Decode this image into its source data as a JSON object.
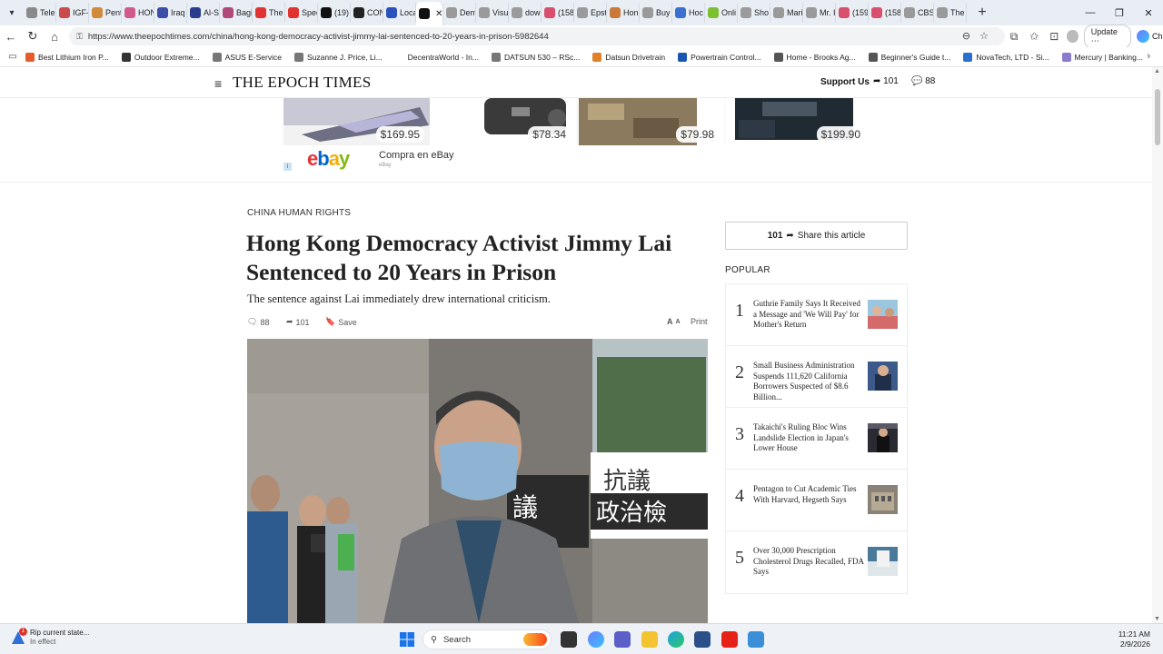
{
  "browser": {
    "tabs": [
      {
        "label": "Tele",
        "color": "#8a8a8a"
      },
      {
        "label": "IGF-",
        "color": "#c94b4b"
      },
      {
        "label": "Pent",
        "color": "#d18a3a"
      },
      {
        "label": "HON",
        "color": "#d25a8a"
      },
      {
        "label": "Iraq",
        "color": "#3b4fa8"
      },
      {
        "label": "Al-S",
        "color": "#2a3d8f"
      },
      {
        "label": "Bagi",
        "color": "#b14a7b"
      },
      {
        "label": "The",
        "color": "#e0332f"
      },
      {
        "label": "Spec",
        "color": "#e0332f"
      },
      {
        "label": "(19)",
        "color": "#111111"
      },
      {
        "label": "CON",
        "color": "#222222"
      },
      {
        "label": "Loca",
        "color": "#2a52be"
      },
      {
        "label": "",
        "color": "#111111",
        "active": true
      },
      {
        "label": "Dem",
        "color": "#9a9a9a"
      },
      {
        "label": "Visu",
        "color": "#9a9a9a"
      },
      {
        "label": "dow",
        "color": "#9a9a9a"
      },
      {
        "label": "(158",
        "color": "#d94f6e"
      },
      {
        "label": "Epst",
        "color": "#9a9a9a"
      },
      {
        "label": "Hon",
        "color": "#c97a3a"
      },
      {
        "label": "Buy",
        "color": "#9a9a9a"
      },
      {
        "label": "Hoc",
        "color": "#3b6fd0"
      },
      {
        "label": "Onli",
        "color": "#7cbf2f"
      },
      {
        "label": "Sho",
        "color": "#9a9a9a"
      },
      {
        "label": "Mari",
        "color": "#9a9a9a"
      },
      {
        "label": "Mr. I",
        "color": "#9a9a9a"
      },
      {
        "label": "(159",
        "color": "#d94f6e"
      },
      {
        "label": "(158",
        "color": "#d94f6e"
      },
      {
        "label": "CBS",
        "color": "#9a9a9a"
      },
      {
        "label": "The",
        "color": "#9a9a9a"
      }
    ],
    "url": "https://www.theepochtimes.com/china/hong-kong-democracy-activist-jimmy-lai-sentenced-to-20-years-in-prison-5982644",
    "update_label": "Update",
    "chat_label": "Chat",
    "bookmarks": [
      {
        "label": "Best Lithium Iron P...",
        "color": "#e55b2b"
      },
      {
        "label": "Outdoor Extreme...",
        "color": "#333333"
      },
      {
        "label": "ASUS E-Service",
        "color": "#777777"
      },
      {
        "label": "Suzanne J. Price, Li...",
        "color": "#777777"
      },
      {
        "label": "DecentraWorld - In...",
        "color": "#ffffff"
      },
      {
        "label": "DATSUN 530 – RSc...",
        "color": "#777777"
      },
      {
        "label": "Datsun Drivetrain",
        "color": "#e0802b"
      },
      {
        "label": "Powertrain Control...",
        "color": "#1a56b0"
      },
      {
        "label": "Home - Brooks Ag...",
        "color": "#555555"
      },
      {
        "label": "Beginner's Guide t...",
        "color": "#555555"
      },
      {
        "label": "NovaTech, LTD - Si...",
        "color": "#2a6fd0"
      },
      {
        "label": "Mercury | Banking...",
        "color": "#8a7bd0"
      }
    ]
  },
  "site": {
    "logo": "THE EPOCH TIMES",
    "support_label": "Support Us",
    "share_count": "101",
    "comment_count": "88"
  },
  "ad": {
    "items": [
      {
        "price": "$169.95"
      },
      {
        "price": "$78.34"
      },
      {
        "price": "$79.98"
      },
      {
        "price": "$199.90"
      }
    ],
    "logo": {
      "e": "e",
      "b": "b",
      "a": "a",
      "y": "y"
    },
    "text": "Compra en eBay",
    "sub": "eBay"
  },
  "article": {
    "category": "CHINA HUMAN RIGHTS",
    "title": "Hong Kong Democracy Activist Jimmy Lai Sentenced to 20 Years in Prison",
    "subtitle": "The sentence against Lai immediately drew international criticism.",
    "comments": "88",
    "shares": "101",
    "save_label": "Save",
    "print_label": "Print",
    "sign_top": "抗議",
    "sign_bottom": "政治檢",
    "sign_left": "議"
  },
  "sidebar": {
    "share_count": "101",
    "share_label": "Share this article",
    "popular_label": "POPULAR",
    "popular": [
      {
        "num": "1",
        "title": "Guthrie Family Says It Received a Message and 'We Will Pay' for Mother's Return"
      },
      {
        "num": "2",
        "title": "Small Business Administration Suspends 111,620 California Borrowers Suspected of $8.6 Billion..."
      },
      {
        "num": "3",
        "title": "Takaichi's Ruling Bloc Wins Landslide Election in Japan's Lower House"
      },
      {
        "num": "4",
        "title": "Pentagon to Cut Academic Ties With Harvard, Hegseth Says"
      },
      {
        "num": "5",
        "title": "Over 30,000 Prescription Cholesterol Drugs Recalled, FDA Says"
      }
    ]
  },
  "taskbar": {
    "weather_badge": "1",
    "weather_title": "Rip current state...",
    "weather_sub": "In effect",
    "search_label": "Search",
    "time": "11:21 AM",
    "date": "2/9/2026"
  }
}
